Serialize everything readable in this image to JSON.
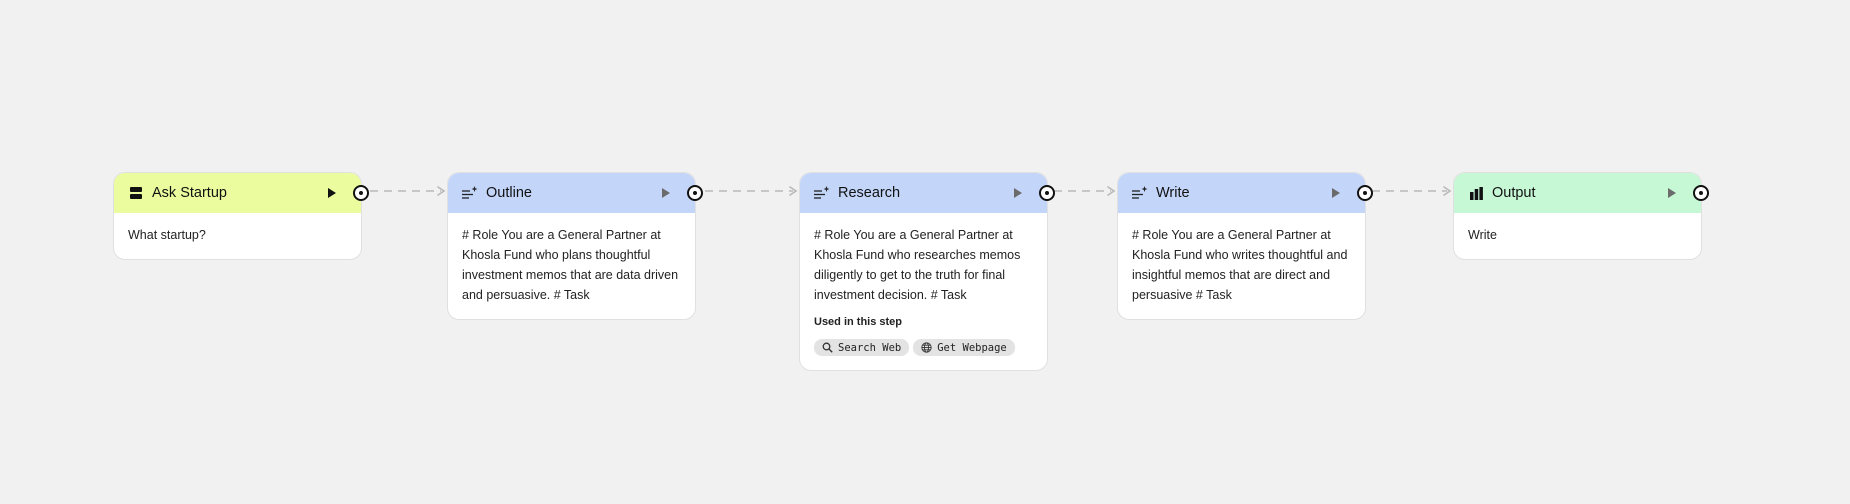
{
  "colors": {
    "canvas_bg": "#f1f1f1",
    "input_header": "#ebfc9f",
    "generate_header": "#c3d6fa",
    "output_header": "#c6f8d6",
    "connector": "#b9b9b9"
  },
  "nodes": [
    {
      "id": "ask-startup",
      "title": "Ask Startup",
      "icon": "input-icon",
      "body": "What startup?"
    },
    {
      "id": "outline",
      "title": "Outline",
      "icon": "generate-icon",
      "body": "# Role You are a General Partner at Khosla Fund who plans thoughtful investment memos that are data driven and persuasive. # Task"
    },
    {
      "id": "research",
      "title": "Research",
      "icon": "generate-icon",
      "body": "# Role You are a General Partner at Khosla Fund who researches memos diligently to get to the truth for final investment decision. # Task",
      "used_label": "Used in this step",
      "tools": [
        {
          "label": "Search Web",
          "icon": "search-icon"
        },
        {
          "label": "Get Webpage",
          "icon": "globe-icon"
        }
      ]
    },
    {
      "id": "write",
      "title": "Write",
      "icon": "generate-icon",
      "body": "# Role You are a General Partner at Khosla Fund who writes thoughtful and insightful memos that are direct and persuasive # Task"
    },
    {
      "id": "output",
      "title": "Output",
      "icon": "output-icon",
      "body": "Write"
    }
  ]
}
